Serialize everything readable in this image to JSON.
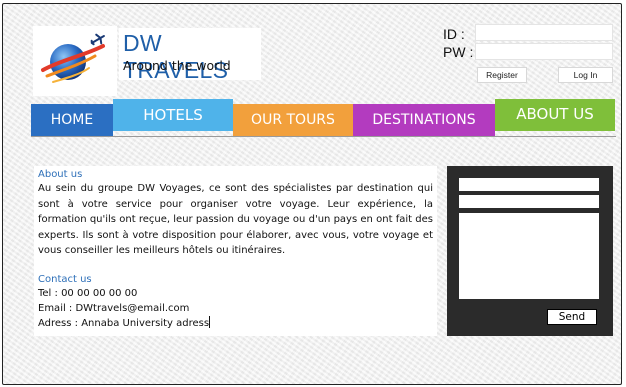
{
  "brand": {
    "title": "DW TRAVELS",
    "subtitle": "Around the world",
    "colors": {
      "title": "#1f5fa8"
    },
    "logo_icon": "globe-airplane-icon"
  },
  "login": {
    "id_label": "ID :",
    "pw_label": "PW :",
    "id_value": "",
    "pw_value": "",
    "register_label": "Register",
    "login_label": "Log In"
  },
  "nav": {
    "tabs": [
      {
        "label": "HOME",
        "color": "#2b6fc2"
      },
      {
        "label": "HOTELS",
        "color": "#4fb3ea"
      },
      {
        "label": "OUR TOURS",
        "color": "#f2a03c"
      },
      {
        "label": "DESTINATIONS",
        "color": "#b33bbf"
      },
      {
        "label": "ABOUT US",
        "color": "#7fbf3a"
      }
    ]
  },
  "about": {
    "heading": "About us",
    "text": "Au sein du groupe DW Voyages, ce sont des spécialistes par destination qui sont à votre service pour organiser votre voyage. Leur expérience, la formation qu'ils ont reçue, leur passion du voyage ou d'un pays en ont fait des experts. Ils sont à votre disposition pour élaborer, avec vous, votre voyage et vous conseiller les meilleurs hôtels ou itinéraires."
  },
  "contact": {
    "heading": "Contact us",
    "tel": "Tel : 00 00 00 00 00",
    "email": "Email : DWtravels@email.com",
    "address": "Adress : Annaba University adress"
  },
  "form": {
    "field1_value": "",
    "field2_value": "",
    "message_value": "",
    "send_label": "Send"
  }
}
